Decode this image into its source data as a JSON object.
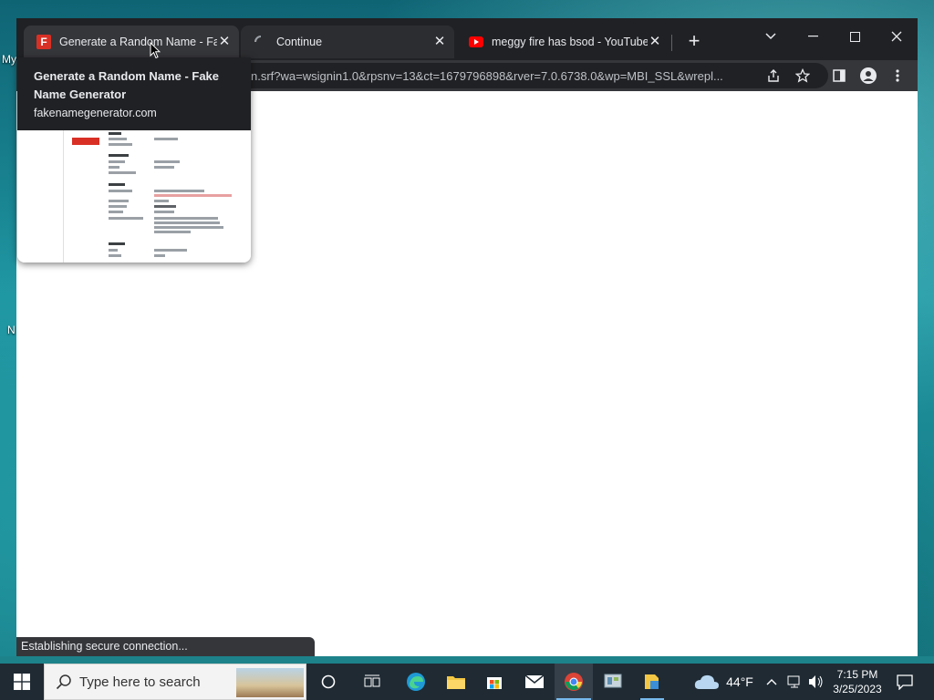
{
  "desktop": {
    "icon_labels": [
      "My",
      "N"
    ]
  },
  "browser": {
    "tabs": [
      {
        "title": "Generate a Random Name - Fake",
        "favicon": "fake-name-generator-icon",
        "favicon_letter": "F",
        "state": "active"
      },
      {
        "title": "Continue",
        "favicon": "loading-spinner-icon",
        "state": "hover"
      },
      {
        "title": "meggy fire has bsod - YouTube",
        "favicon": "youtube-icon",
        "state": "inactive"
      }
    ],
    "omnibox_url": "n.srf?wa=wsignin1.0&rpsnv=13&ct=1679796898&rver=7.0.6738.0&wp=MBI_SSL&wrepl...",
    "status_text": "Establishing secure connection...",
    "hover_card": {
      "title": "Generate a Random Name - Fake Name Generator",
      "domain": "fakenamegenerator.com"
    }
  },
  "taskbar": {
    "search_placeholder": "Type here to search",
    "weather_temp": "44°F",
    "time": "7:15 PM",
    "date": "3/25/2023"
  },
  "colors": {
    "tabstrip": "#202124",
    "toolbar": "#35363a",
    "taskbar": "#1f2a33",
    "favicon_red": "#d93025",
    "youtube_red": "#ff0000"
  }
}
